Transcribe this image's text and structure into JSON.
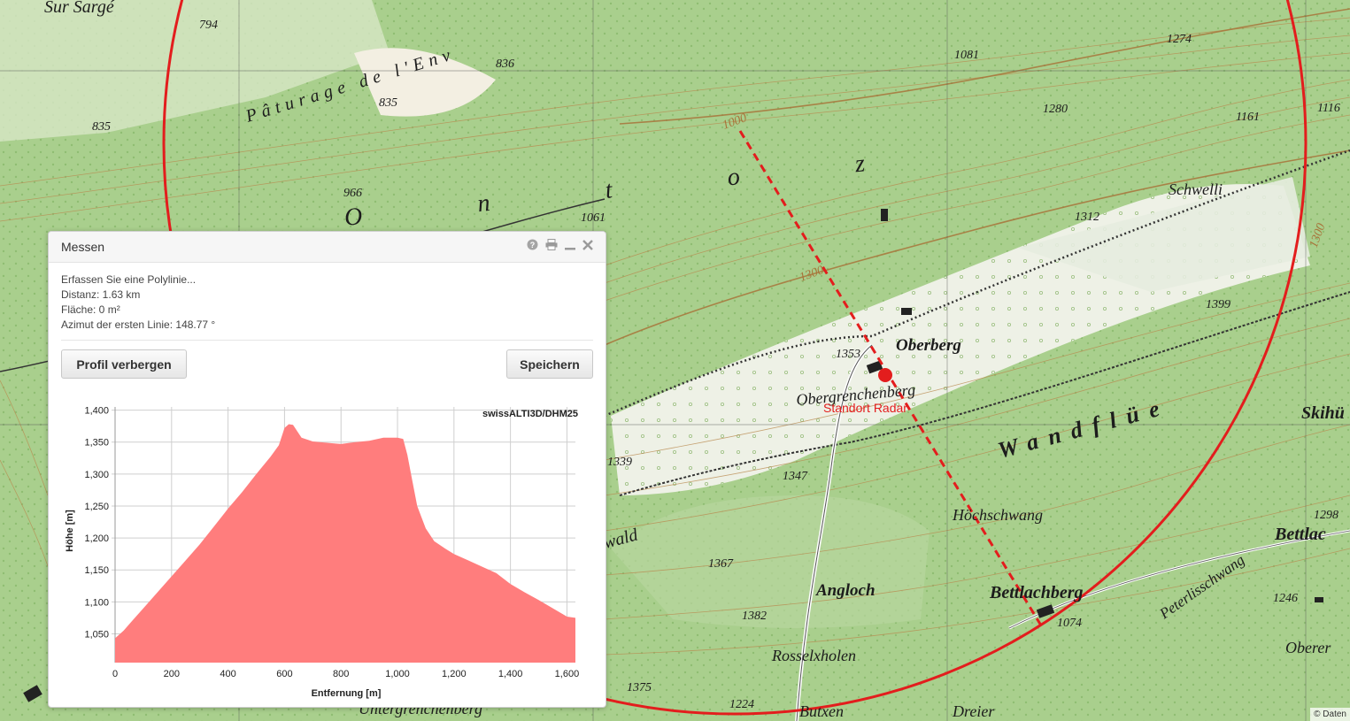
{
  "map": {
    "labels": [
      {
        "text": "Sur Sargé"
      },
      {
        "text": "Pâturage de l'Env"
      },
      {
        "text": "O n t o z"
      },
      {
        "text": "Schwelli"
      },
      {
        "text": "Oberberg"
      },
      {
        "text": "Obergrenchenberg"
      },
      {
        "text": "Wandflüe"
      },
      {
        "text": "Höchschwang"
      },
      {
        "text": "Angloch"
      },
      {
        "text": "Bettlachberg"
      },
      {
        "text": "Peterlisschwang"
      },
      {
        "text": "Rosselxholen"
      },
      {
        "text": "Butxen"
      },
      {
        "text": "Dreier"
      },
      {
        "text": "Bettlac"
      },
      {
        "text": "Skihü"
      },
      {
        "text": "Oberer"
      },
      {
        "text": "Untergrenchenberg"
      },
      {
        "text": "wald"
      }
    ],
    "altitudes": [
      "794",
      "836",
      "835",
      "835",
      "966",
      "1061",
      "1081",
      "1274",
      "1280",
      "1161",
      "1116",
      "1312",
      "1000",
      "1300",
      "1353",
      "1399",
      "1339",
      "1347",
      "1367",
      "1382",
      "1375",
      "1224",
      "1074",
      "1246",
      "1298",
      "1300"
    ],
    "radar_label": "Standort Radar",
    "copyright": "© Daten",
    "colors": {
      "measure_line": "#e31d1d",
      "circle": "#e31d1d",
      "forest": "#a9cf8d",
      "contour": "#b9894e"
    }
  },
  "panel": {
    "title": "Messen",
    "icons": [
      "help-icon",
      "print-icon",
      "minimize-icon",
      "close-icon"
    ],
    "info": {
      "line1": "Erfassen Sie eine Polylinie...",
      "line2": "Distanz: 1.63 km",
      "line3": "Fläche: 0 m²",
      "line4": "Azimut der ersten Linie: 148.77 °"
    },
    "buttons": {
      "profile": "Profil verbergen",
      "save": "Speichern"
    }
  },
  "chart_data": {
    "type": "area",
    "source_label": "swissALTI3D/DHM25",
    "xlabel": "Entfernung [m]",
    "ylabel": "Höhe [m]",
    "xlim": [
      0,
      1630
    ],
    "ylim": [
      1005,
      1405
    ],
    "x_ticks": [
      "0",
      "200",
      "400",
      "600",
      "800",
      "1,000",
      "1,200",
      "1,400",
      "1,600"
    ],
    "y_ticks": [
      "1,050",
      "1,100",
      "1,150",
      "1,200",
      "1,250",
      "1,300",
      "1,350",
      "1,400"
    ],
    "color": "#ff7d7d",
    "x": [
      0,
      30,
      60,
      100,
      150,
      200,
      250,
      300,
      350,
      400,
      450,
      500,
      550,
      580,
      600,
      615,
      630,
      660,
      700,
      750,
      800,
      850,
      900,
      950,
      1000,
      1020,
      1035,
      1050,
      1070,
      1100,
      1130,
      1170,
      1200,
      1250,
      1300,
      1350,
      1400,
      1450,
      1500,
      1550,
      1600,
      1630
    ],
    "y": [
      1043,
      1055,
      1070,
      1090,
      1115,
      1140,
      1165,
      1190,
      1218,
      1246,
      1272,
      1300,
      1327,
      1345,
      1372,
      1378,
      1377,
      1357,
      1351,
      1349,
      1347,
      1350,
      1352,
      1357,
      1357,
      1355,
      1330,
      1295,
      1250,
      1215,
      1195,
      1183,
      1175,
      1165,
      1155,
      1145,
      1128,
      1115,
      1103,
      1090,
      1077,
      1075
    ]
  }
}
